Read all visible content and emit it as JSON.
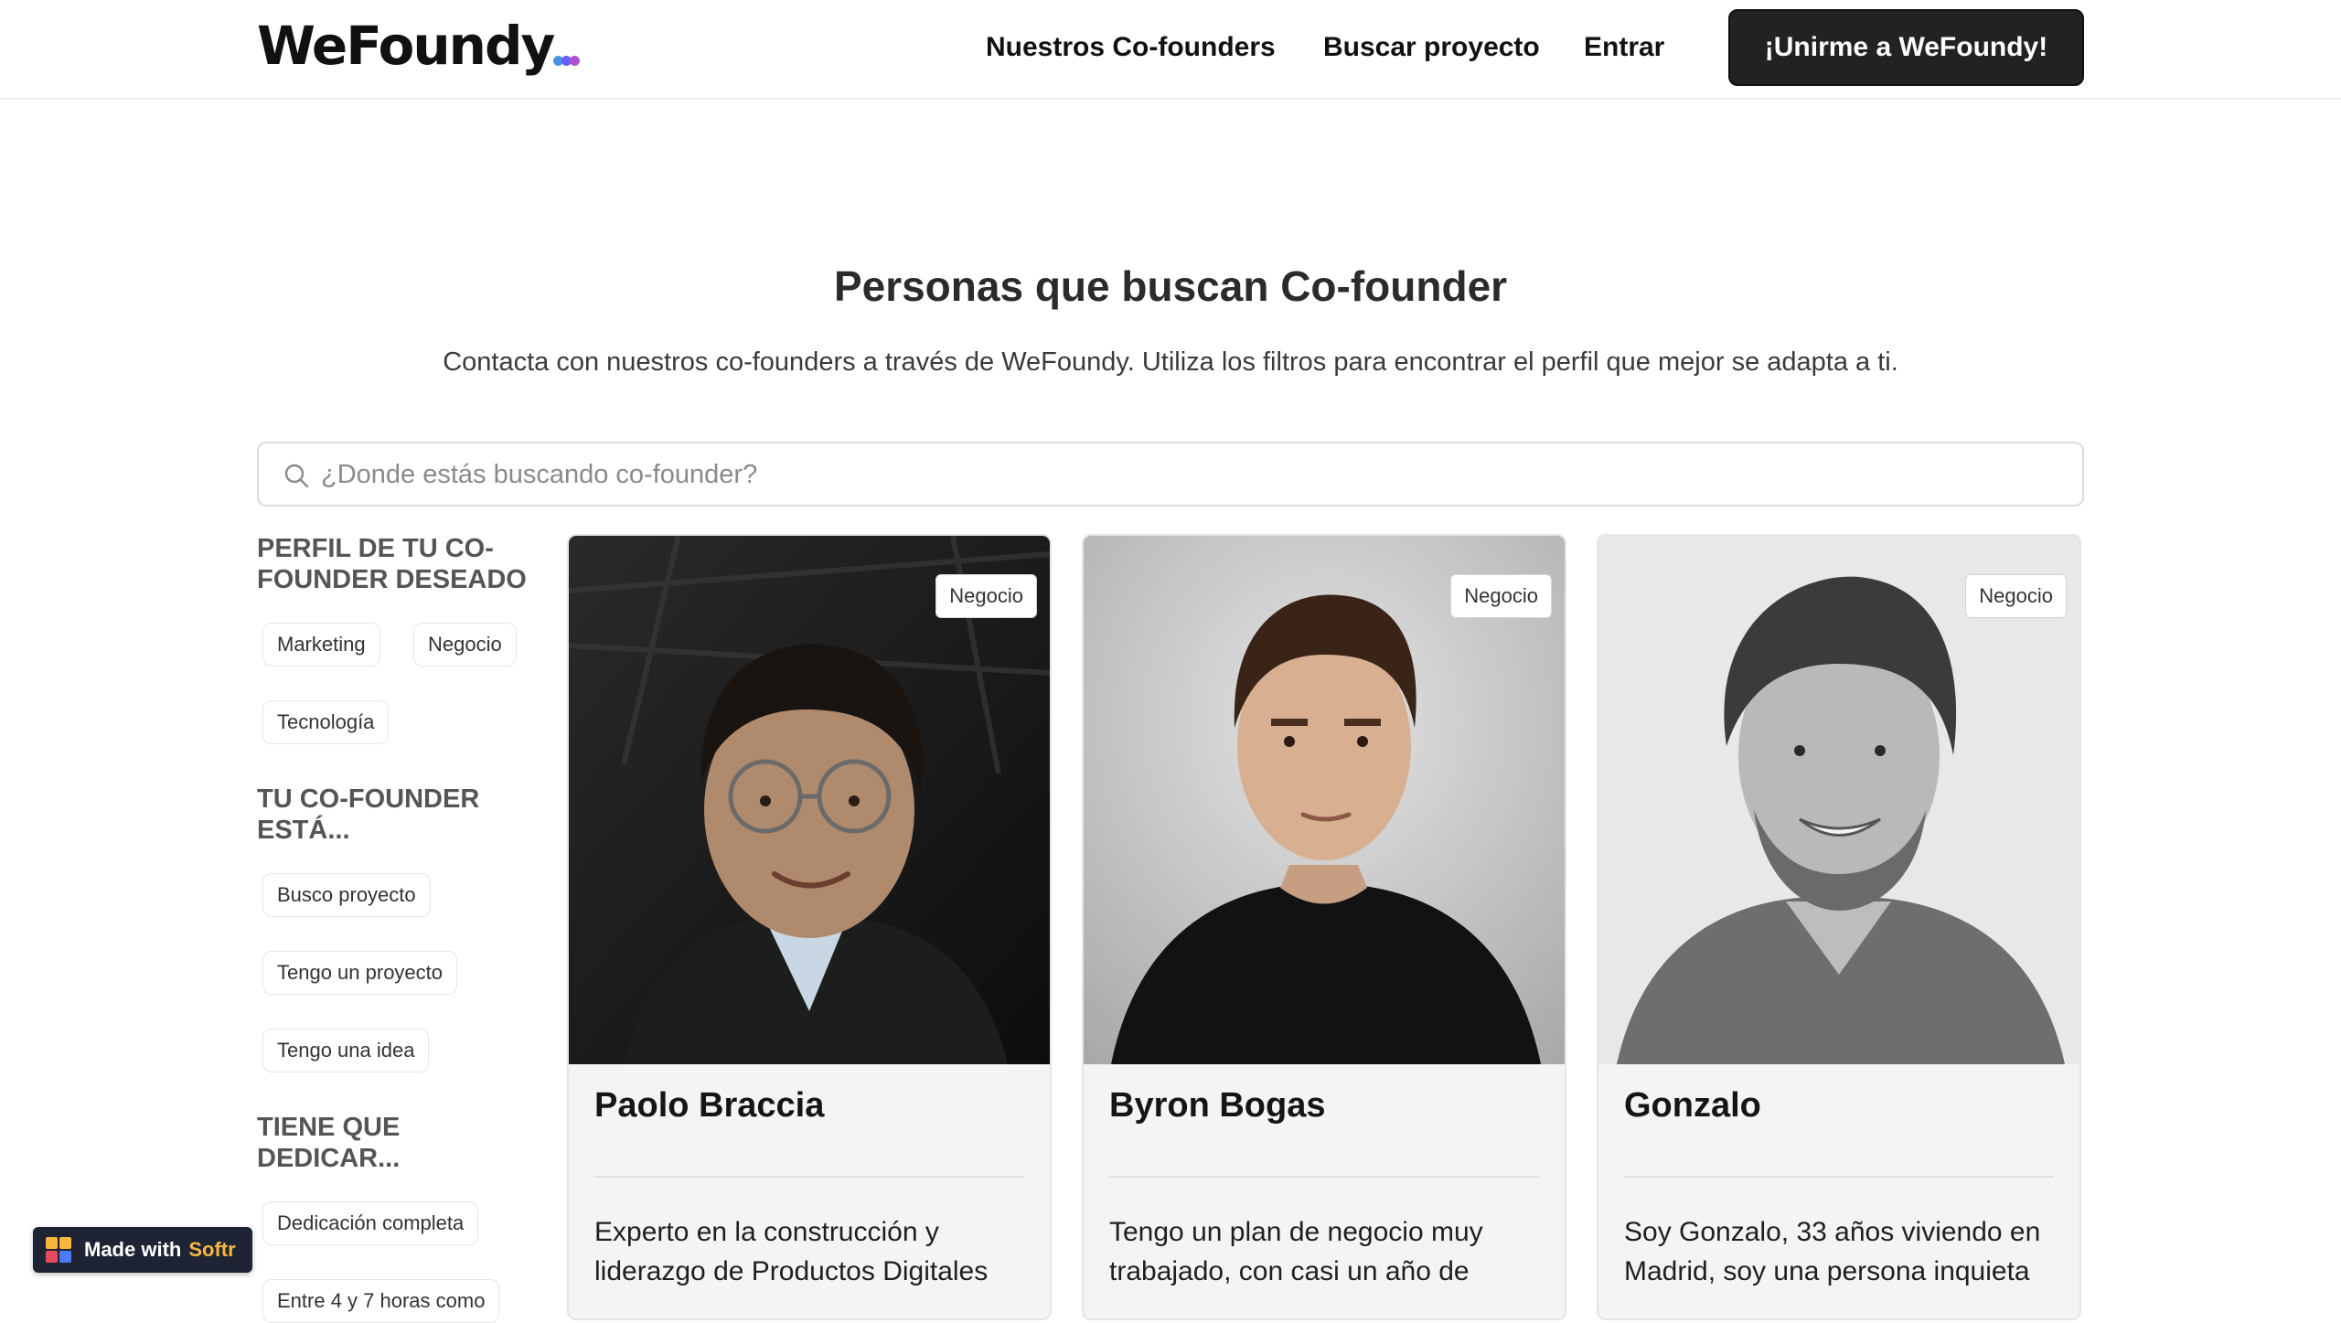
{
  "header": {
    "logo_text": "WeFoundy",
    "logo_dot_colors": [
      "#6b5cff",
      "#b14fd0",
      "#4a90e2"
    ],
    "nav": {
      "cofounders": "Nuestros Co-founders",
      "buscar": "Buscar proyecto",
      "entrar": "Entrar"
    },
    "cta_label": "¡Unirme a WeFoundy!"
  },
  "hero": {
    "title": "Personas que buscan Co-founder",
    "subtitle": "Contacta con nuestros co-founders a través de WeFoundy. Utiliza los filtros para encontrar el perfil que mejor se adapta a ti."
  },
  "search": {
    "placeholder": "¿Donde estás buscando co-founder?",
    "value": ""
  },
  "filters": {
    "perfil": {
      "heading": "PERFIL DE TU CO-FOUNDER DESEADO",
      "options": [
        "Marketing",
        "Negocio",
        "Tecnología"
      ]
    },
    "estado": {
      "heading": "TU CO-FOUNDER ESTÁ...",
      "options": [
        "Busco proyecto",
        "Tengo un proyecto",
        "Tengo una idea"
      ]
    },
    "dedicacion": {
      "heading": "TIENE QUE DEDICAR...",
      "options": [
        "Dedicación completa",
        "Entre 4 y 7 horas como"
      ]
    }
  },
  "cards": [
    {
      "badge": "Negocio",
      "name": "Paolo Braccia",
      "bio": "Experto en la construcción y liderazgo de Productos Digitales"
    },
    {
      "badge": "Negocio",
      "name": "Byron Bogas",
      "bio": "Tengo un plan de negocio muy trabajado, con casi un año de"
    },
    {
      "badge": "Negocio",
      "name": "Gonzalo",
      "bio": "Soy Gonzalo, 33 años viviendo en Madrid, soy una persona inquieta"
    }
  ],
  "softr_badge": {
    "made_with": "Made with",
    "brand": "Softr",
    "brand_color": "#f6b73c"
  }
}
